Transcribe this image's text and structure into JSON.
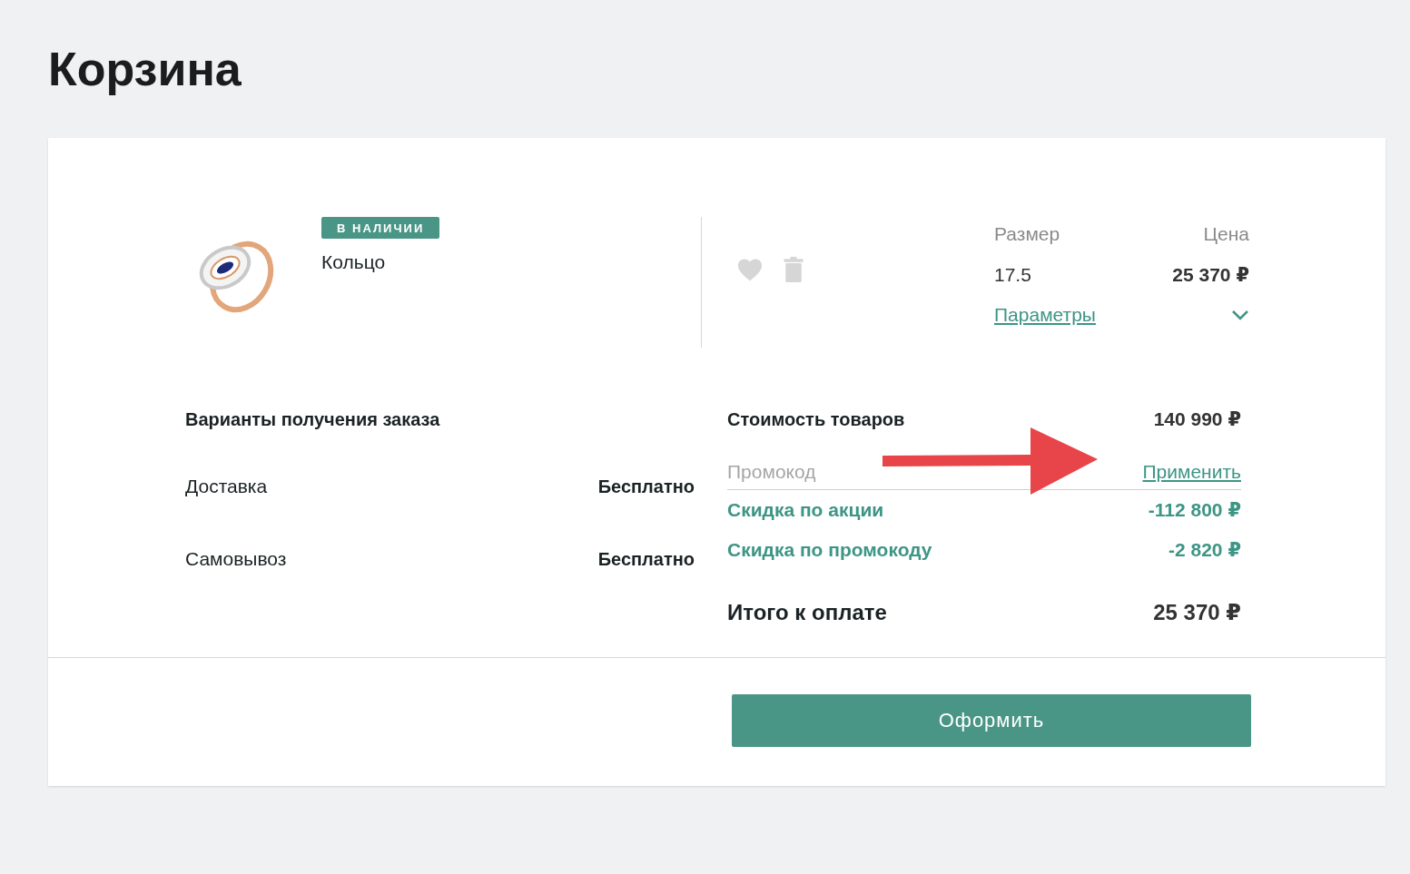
{
  "title": "Корзина",
  "item": {
    "badge": "В НАЛИЧИИ",
    "name": "Кольцо",
    "size_label": "Размер",
    "size": "17.5",
    "price_label": "Цена",
    "price": "25 370 ₽",
    "params_link": "Параметры"
  },
  "delivery": {
    "heading": "Варианты получения заказа",
    "options": [
      {
        "name": "Доставка",
        "price": "Бесплатно"
      },
      {
        "name": "Самовывоз",
        "price": "Бесплатно"
      }
    ]
  },
  "summary": {
    "goods_label": "Стоимость товаров",
    "goods_value": "140 990 ₽",
    "promo_placeholder": "Промокод",
    "apply": "Применить",
    "discounts": [
      {
        "label": "Скидка по акции",
        "value": "-112 800 ₽"
      },
      {
        "label": "Скидка по промокоду",
        "value": "-2 820 ₽"
      }
    ],
    "total_label": "Итого к оплате",
    "total_value": "25 370 ₽"
  },
  "checkout_button": "Оформить"
}
